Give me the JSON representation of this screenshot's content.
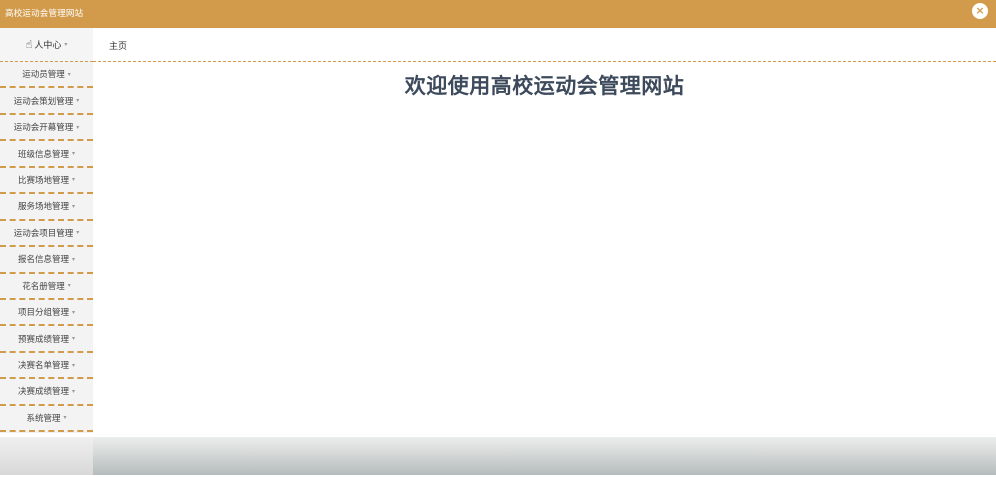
{
  "app": {
    "title": "高校运动会管理网站",
    "close_icon": "×"
  },
  "profile": {
    "label": "人中心",
    "icon": "☝",
    "caret": "▾"
  },
  "sidebar": {
    "caret": "▾",
    "items": [
      {
        "label": "运动员管理"
      },
      {
        "label": "运动会策划管理"
      },
      {
        "label": "运动会开幕管理"
      },
      {
        "label": "班级信息管理"
      },
      {
        "label": "比赛场地管理"
      },
      {
        "label": "服务场地管理"
      },
      {
        "label": "运动会项目管理"
      },
      {
        "label": "报名信息管理"
      },
      {
        "label": "花名册管理"
      },
      {
        "label": "项目分组管理"
      },
      {
        "label": "预赛成绩管理"
      },
      {
        "label": "决赛名单管理"
      },
      {
        "label": "决赛成绩管理"
      },
      {
        "label": "系统管理"
      }
    ]
  },
  "breadcrumb": {
    "home": "主页"
  },
  "main": {
    "welcome": "欢迎使用高校运动会管理网站"
  },
  "colors": {
    "accent": "#d19b4b",
    "heading": "#3d4a5c"
  }
}
